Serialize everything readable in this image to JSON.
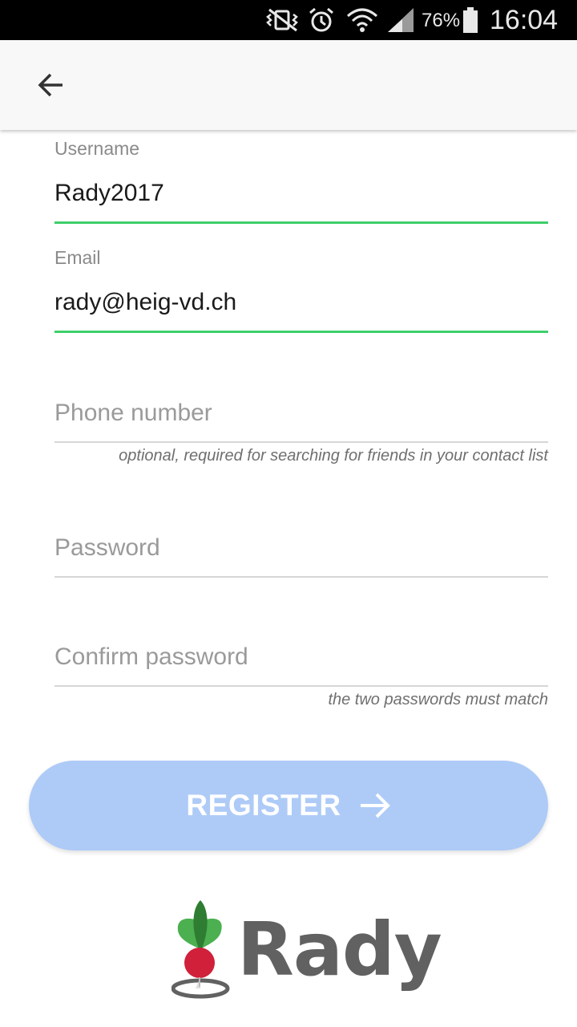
{
  "status_bar": {
    "battery_percent": "76%",
    "time": "16:04",
    "icons": [
      "vibrate-mute-icon",
      "alarm-icon",
      "wifi-icon",
      "signal-icon",
      "battery-icon"
    ]
  },
  "app_bar": {
    "back_icon": "arrow-left-icon"
  },
  "form": {
    "username": {
      "label": "Username",
      "value": "Rady2017"
    },
    "email": {
      "label": "Email",
      "value": "rady@heig-vd.ch"
    },
    "phone": {
      "placeholder": "Phone number",
      "hint": "optional, required for searching for friends in your contact list"
    },
    "password": {
      "placeholder": "Password"
    },
    "confirm_password": {
      "placeholder": "Confirm password",
      "hint": "the two passwords must match"
    },
    "register_button": {
      "label": "REGISTER",
      "icon": "arrow-right-icon"
    }
  },
  "logo": {
    "text": "Rady"
  },
  "colors": {
    "active_underline": "#3ecf6a",
    "button_bg": "#aecbf7",
    "logo_text": "#616161",
    "radish_red": "#d0203a",
    "leaf_green_dark": "#2e7d32",
    "leaf_green_light": "#4caf50"
  }
}
